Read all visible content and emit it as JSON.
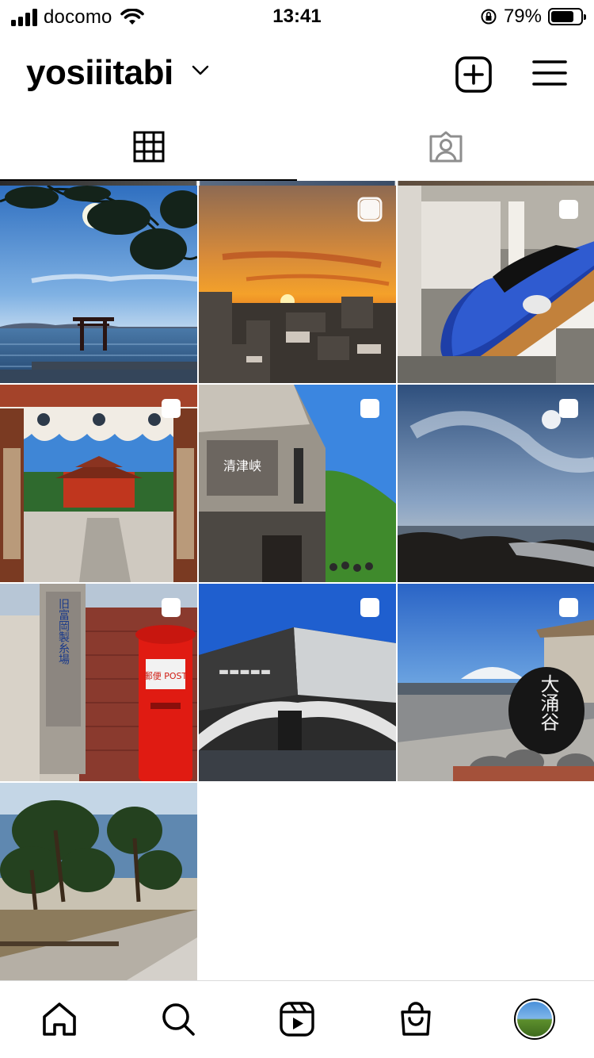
{
  "status_bar": {
    "carrier": "docomo",
    "time": "13:41",
    "battery_percent": "79%",
    "battery_level": 0.79
  },
  "header": {
    "username": "yosiiitabi",
    "icons": [
      "chevron-down-icon",
      "new-post-icon",
      "menu-icon"
    ]
  },
  "tabs": [
    {
      "icon": "grid-icon",
      "active": true
    },
    {
      "icon": "tagged-icon",
      "active": false
    }
  ],
  "grid": {
    "posts": [
      {
        "subject": "torii-in-lake",
        "multi": false
      },
      {
        "subject": "sunset-over-city",
        "multi": true
      },
      {
        "subject": "shinkansen-train",
        "multi": true
      },
      {
        "subject": "shrine-gate",
        "multi": true
      },
      {
        "subject": "kiyotsukyo-building",
        "multi": true,
        "sign_text": "清津峡"
      },
      {
        "subject": "rocky-coast",
        "multi": true
      },
      {
        "subject": "mailbox-and-mill",
        "multi": true,
        "sign_text": "旧富岡製糸場",
        "mailbox_text": "郵便 POST"
      },
      {
        "subject": "museum-building",
        "multi": true
      },
      {
        "subject": "owakudani-stone",
        "multi": true,
        "stone_text": "大涌谷"
      },
      {
        "subject": "pine-trees-coast",
        "multi": false
      }
    ]
  },
  "nav": {
    "items": [
      "home-icon",
      "search-icon",
      "reels-icon",
      "shop-icon",
      "profile-avatar"
    ]
  }
}
